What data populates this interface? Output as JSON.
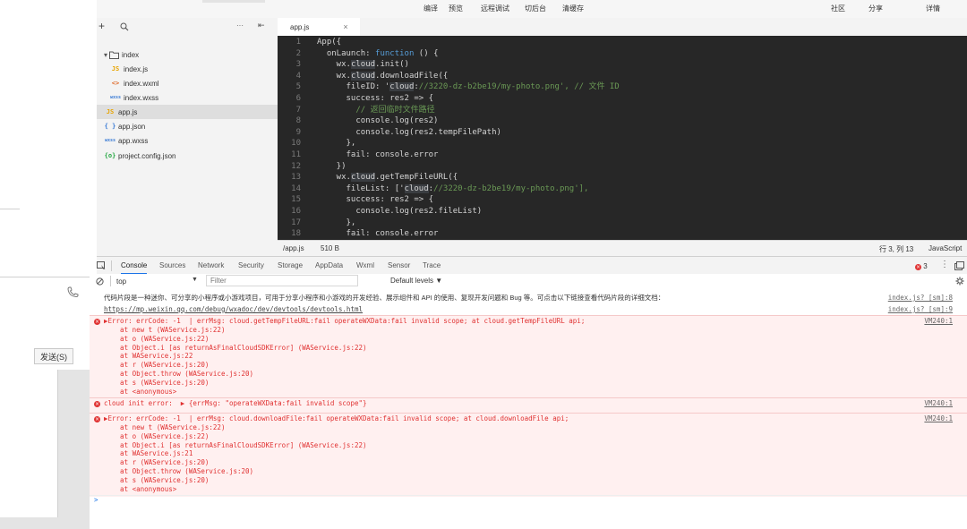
{
  "toolbar": {
    "items": [
      "编译",
      "预览",
      "远程调试",
      "切后台",
      "清缓存"
    ],
    "right_items": [
      "社区",
      "分享",
      "详情"
    ]
  },
  "sidebar": {
    "send_label": "发送(S)"
  },
  "explorer": {
    "add_label": "+",
    "more_label": "···",
    "files": [
      {
        "icon": "▸",
        "name": "index",
        "type": "folder"
      },
      {
        "icon": "JS",
        "name": "index.js",
        "type": "js"
      },
      {
        "icon": "<>",
        "name": "index.wxml",
        "type": "wxml"
      },
      {
        "icon": "wxss",
        "name": "index.wxss",
        "type": "wxss"
      },
      {
        "icon": "JS",
        "name": "app.js",
        "type": "js"
      },
      {
        "icon": "{ }",
        "name": "app.json",
        "type": "json"
      },
      {
        "icon": "wxss",
        "name": "app.wxss",
        "type": "wxss"
      },
      {
        "icon": "{o}",
        "name": "project.config.json",
        "type": "config"
      }
    ]
  },
  "editor": {
    "tab_label": "app.js",
    "lines": [
      "App({",
      "  onLaunch: function () {",
      "    wx.cloud.init()",
      "    wx.cloud.downloadFile({",
      "      fileID: 'cloud://3220-dz-b2be19/my-photo.png', // 文件 ID",
      "      success: res2 => {",
      "        // 返回临时文件路径",
      "        console.log(res2)",
      "        console.log(res2.tempFilePath)",
      "      },",
      "      fail: console.error",
      "    })",
      "    wx.cloud.getTempFileURL({",
      "      fileList: ['cloud://3220-dz-b2be19/my-photo.png'],",
      "      success: res2 => {",
      "        console.log(res2.fileList)",
      "      },",
      "      fail: console.error"
    ]
  },
  "status": {
    "path": "/app.js",
    "size": "510 B",
    "position": "行 3, 列 13",
    "language": "JavaScript"
  },
  "devtools": {
    "tabs": [
      "Console",
      "Sources",
      "Network",
      "Security",
      "Storage",
      "AppData",
      "Wxml",
      "Sensor",
      "Trace"
    ],
    "active_tab": "Console",
    "error_count": "3",
    "context": "top",
    "filter_placeholder": "Filter",
    "levels": "Default levels ▼"
  },
  "console": {
    "info_line": "代码片段是一种迷你、可分享的小程序或小游戏项目，可用于分享小程序和小游戏的开发经验、展示组件和 API 的使用、复现开发问题和 Bug 等。可点击以下链接查看代码片段的详细文档：",
    "info_source": "index.js? [sm]:8",
    "info_link": "https://mp.weixin.qq.com/debug/wxadoc/dev/devtools/devtools.html",
    "info_link_source": "index.js? [sm]:9",
    "errors": [
      {
        "message": "▶Error: errCode: -1  | errMsg: cloud.getTempFileURL:fail operateWXData:fail invalid scope; at cloud.getTempFileURL api;",
        "source": "VM240:1",
        "stack": [
          "    at new t (WAService.js:22)",
          "    at o (WAService.js:22)",
          "    at Object.i [as returnAsFinalCloudSDKError] (WAService.js:22)",
          "    at WAService.js:22",
          "    at r (WAService.js:20)",
          "    at Object.throw (WAService.js:20)",
          "    at s (WAService.js:20)",
          "    at <anonymous>"
        ]
      },
      {
        "message": "cloud init error:  ▶ {errMsg: \"operateWXData:fail invalid scope\"}",
        "source": "VM240:1",
        "stack": []
      },
      {
        "message": "▶Error: errCode: -1  | errMsg: cloud.downloadFile:fail operateWXData:fail invalid scope; at cloud.downloadFile api;",
        "source": "VM240:1",
        "stack": [
          "    at new t (WAService.js:22)",
          "    at o (WAService.js:22)",
          "    at Object.i [as returnAsFinalCloudSDKError] (WAService.js:22)",
          "    at WAService.js:21",
          "    at r (WAService.js:20)",
          "    at Object.throw (WAService.js:20)",
          "    at s (WAService.js:20)",
          "    at <anonymous>"
        ]
      }
    ],
    "prompt": ">"
  }
}
